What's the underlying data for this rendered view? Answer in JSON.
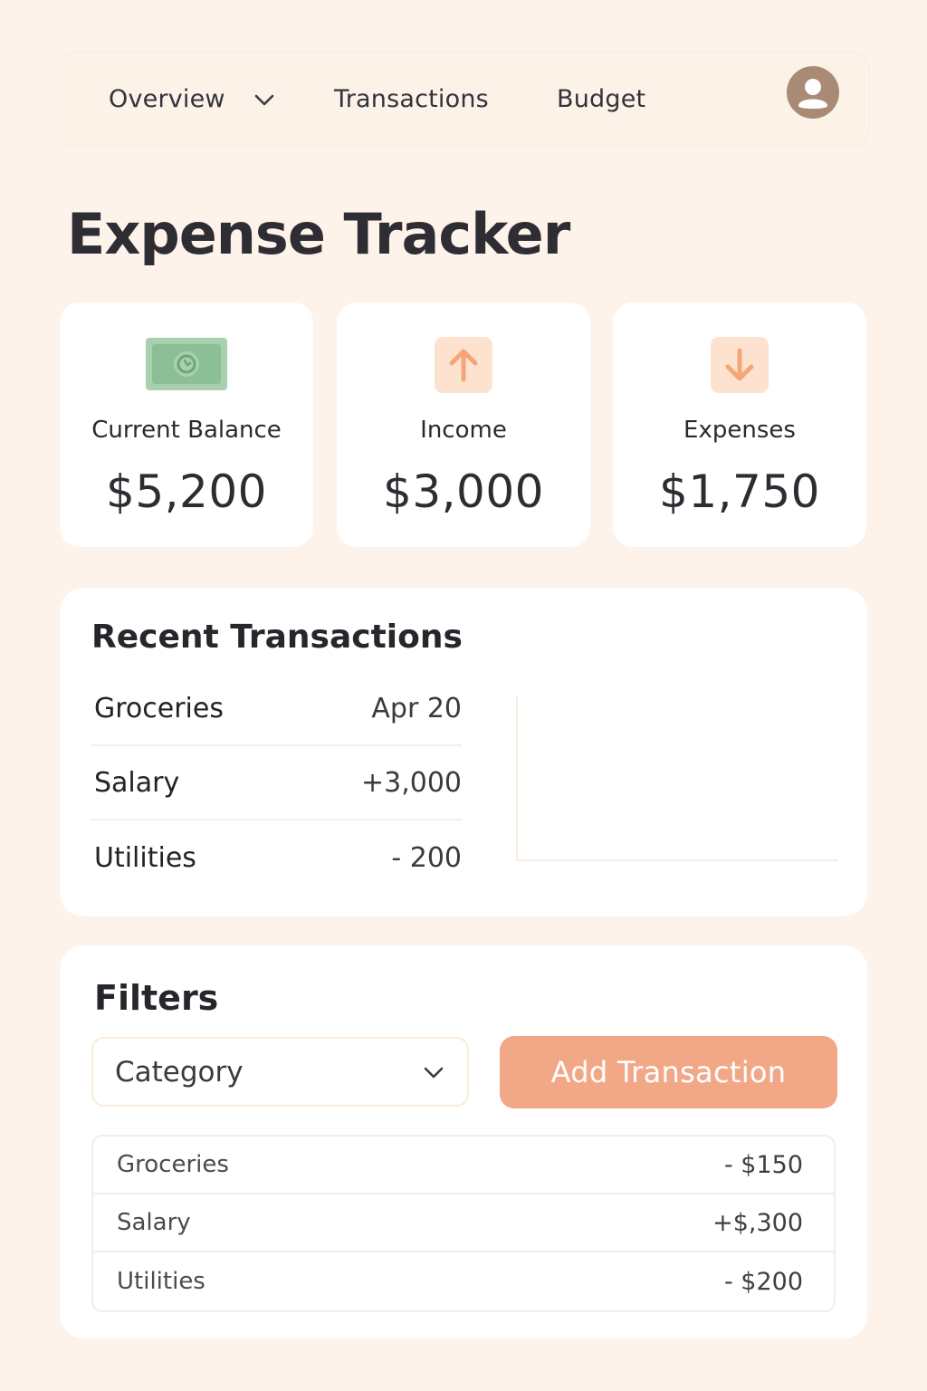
{
  "nav": {
    "items": [
      {
        "label": "Overview",
        "has_dropdown": true
      },
      {
        "label": "Transactions"
      },
      {
        "label": "Budget"
      }
    ],
    "avatar_icon": "user-avatar-icon"
  },
  "page_title": "Expense Tracker",
  "stats": [
    {
      "label": "Current Balance",
      "value": "$5,200",
      "icon": "cash-bill-icon",
      "icon_color": "#9ccaa4"
    },
    {
      "label": "Income",
      "value": "$3,000",
      "icon": "arrow-up-icon",
      "icon_color": "#f5a679"
    },
    {
      "label": "Expenses",
      "value": "$1,750",
      "icon": "arrow-down-icon",
      "icon_color": "#f5a679"
    }
  ],
  "recent": {
    "title": "Recent Transactions",
    "rows": [
      {
        "name": "Groceries",
        "amount": "Apr 20"
      },
      {
        "name": "Salary",
        "amount": "+3,000"
      },
      {
        "name": "Utilities",
        "amount": "- 200"
      }
    ]
  },
  "filters": {
    "title": "Filters",
    "category_select": "Category",
    "add_button": "Add Transaction",
    "rows": [
      {
        "name": "Groceries",
        "amount": "- $150"
      },
      {
        "name": "Salary",
        "amount": "+$,300"
      },
      {
        "name": "Utilities",
        "amount": "- $200"
      }
    ]
  },
  "colors": {
    "background": "#fdf3ea",
    "card": "#ffffff",
    "accent": "#f2a887",
    "money_green": "#9ccaa4"
  }
}
